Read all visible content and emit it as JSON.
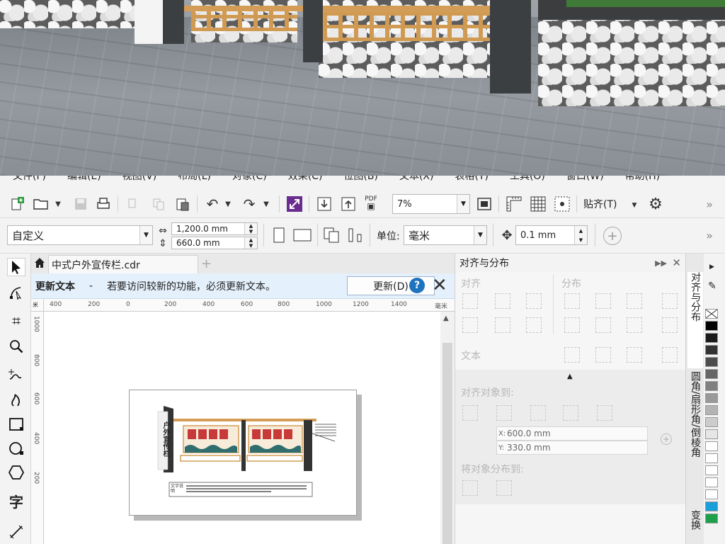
{
  "menu": [
    "文件(F)",
    "编辑(E)",
    "视图(V)",
    "布局(L)",
    "对象(C)",
    "效果(C)",
    "位图(B)",
    "文本(X)",
    "表格(T)",
    "工具(O)",
    "窗口(W)",
    "帮助(H)"
  ],
  "toolbar": {
    "zoom": "7%",
    "pdf_label": "PDF",
    "snap_label": "贴齐(T)"
  },
  "propbar": {
    "preset": "自定义",
    "width": "1,200.0 mm",
    "height": "660.0 mm",
    "unit_label": "单位:",
    "unit_value": "毫米",
    "nudge": "0.1 mm"
  },
  "document": {
    "tab_title": "中式户外宣传栏.cdr"
  },
  "banner": {
    "title": "更新文本",
    "dash": "-",
    "message": "若要访问较新的功能，必须更新文本。",
    "button": "更新(D)",
    "help": "?"
  },
  "ruler": {
    "h_ticks": [
      "400",
      "200",
      "0",
      "200",
      "400",
      "600",
      "800",
      "1000",
      "1200",
      "1400"
    ],
    "h_unit": "毫米",
    "v_ticks": [
      "1000",
      "800",
      "600",
      "400",
      "200"
    ],
    "corner": "米"
  },
  "design": {
    "vertical_title": "户外宣传栏",
    "caption": "文字说明"
  },
  "docker": {
    "title": "对齐与分布",
    "align_label": "对齐",
    "distribute_label": "分布",
    "text_label": "文本",
    "align_to_label": "对齐对象到:",
    "x_label": "X:",
    "x_value": "600.0 mm",
    "y_label": "Y:",
    "y_value": "330.0 mm",
    "distribute_to_label": "将对象分布到:"
  },
  "vtabs": [
    "对齐与分布",
    "圆角/扇形角/倒棱角",
    "变换"
  ],
  "palette": [
    "#ffffff",
    "#000000",
    "#1a1a1a",
    "#333333",
    "#4d4d4d",
    "#666666",
    "#808080",
    "#999999",
    "#b3b3b3",
    "#cccccc",
    "#e6e6e6",
    "#ffffff",
    "#ffffff",
    "#ffffff",
    "#ffffff",
    "#ffffff",
    "#1b9fd8",
    "#1ca04b"
  ]
}
